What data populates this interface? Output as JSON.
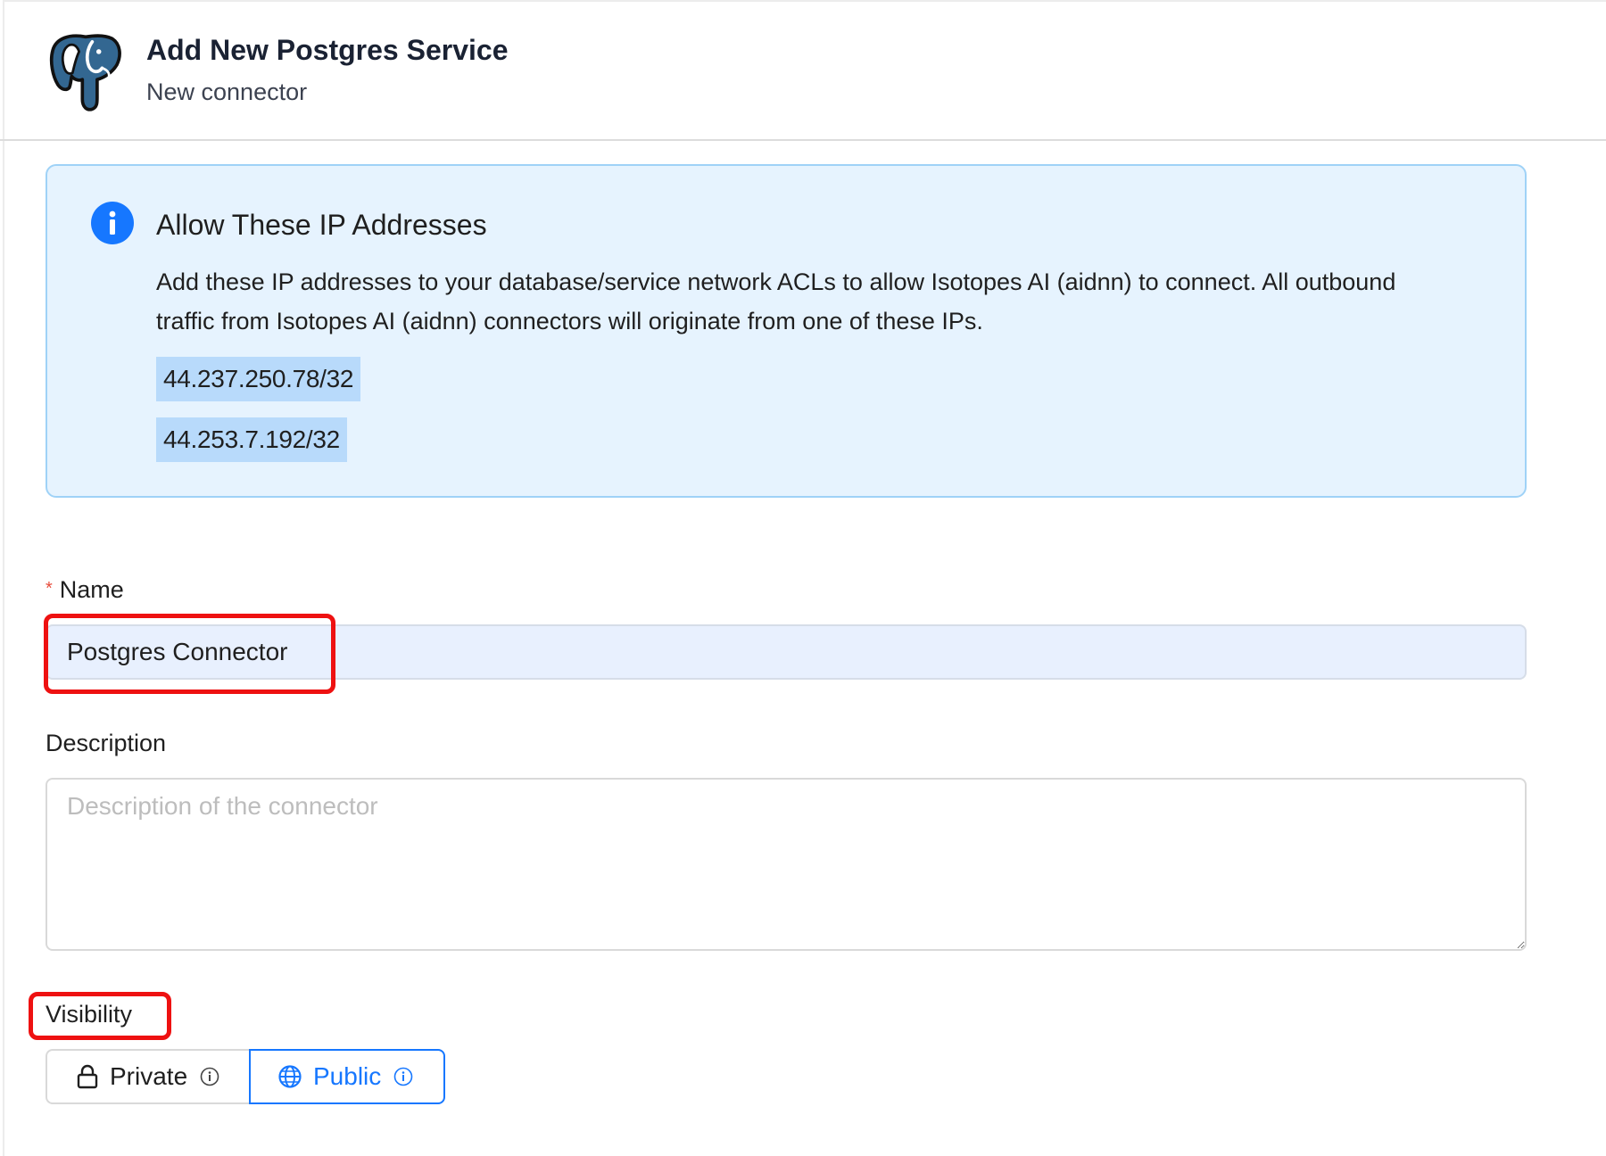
{
  "header": {
    "title": "Add New Postgres Service",
    "subtitle": "New connector",
    "logo_icon": "postgresql-elephant-icon"
  },
  "banner": {
    "icon": "info-icon",
    "title": "Allow These IP Addresses",
    "description": "Add these IP addresses to your database/service network ACLs to allow Isotopes AI (aidnn) to connect. All outbound traffic from Isotopes AI (aidnn) connectors will originate from one of these IPs.",
    "ip_addresses": [
      "44.237.250.78/32",
      "44.253.7.192/32"
    ]
  },
  "form": {
    "name": {
      "label": "Name",
      "required_marker": "*",
      "value": "Postgres Connector"
    },
    "description": {
      "label": "Description",
      "placeholder": "Description of the connector",
      "value": ""
    },
    "visibility": {
      "label": "Visibility",
      "options": [
        {
          "label": "Private",
          "icon": "lock-icon",
          "selected": false
        },
        {
          "label": "Public",
          "icon": "globe-icon",
          "selected": true
        }
      ]
    }
  },
  "colors": {
    "accent": "#1677ff",
    "banner_bg": "#e6f3fe",
    "banner_border": "#9fd2f7",
    "ip_chip_bg": "#b8dafb",
    "highlight": "#ee1111",
    "required": "#e74c3c"
  }
}
